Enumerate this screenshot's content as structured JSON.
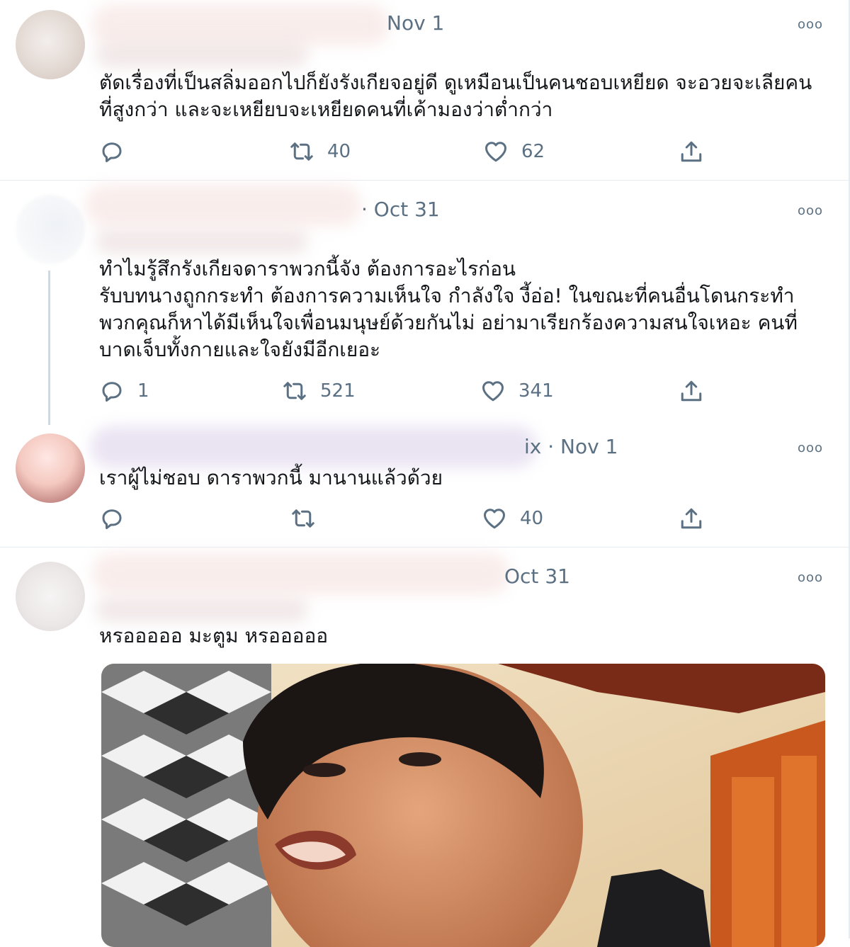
{
  "tweets": [
    {
      "date": "Nov 1",
      "text": "ตัดเรื่องที่เป็นสลิ่มออกไปก็ยังรังเกียจอยู่ดี ดูเหมือนเป็นคนชอบเหยียด จะอวยจะเลียคนที่สูงกว่า และจะเหยียบจะเหยียดคนที่เค้ามองว่าต่ำกว่า",
      "replies": "",
      "retweets": "40",
      "likes": "62"
    },
    {
      "date": "· Oct 31",
      "text": "ทำไมรู้สึกรังเกียจดาราพวกนี้จัง ต้องการอะไรก่อน\nรับบทนางถูกกระทำ ต้องการความเห็นใจ กำลังใจ งี้อ่อ! ในขณะที่คนอื่นโดนกระทำ\nพวกคุณก็หาได้มีเห็นใจเพื่อนมนุษย์ด้วยกันไม่ อย่ามาเรียกร้องความสนใจเหอะ คนที่\nบาดเจ็บทั้งกายและใจยังมีอีกเยอะ",
      "replies": "1",
      "retweets": "521",
      "likes": "341"
    },
    {
      "date": "ix · Nov 1",
      "text": "เราผู้ไม่ชอบ ดาราพวกนี้ มานานแล้วด้วย",
      "replies": "",
      "retweets": "",
      "likes": "40"
    },
    {
      "date": "Oct 31",
      "text": "หรอออออ มะตูม หรอออออ",
      "replies": "",
      "retweets": "",
      "likes": ""
    }
  ],
  "icons": {
    "reply": "reply-icon",
    "retweet": "retweet-icon",
    "like": "heart-icon",
    "share": "share-icon",
    "more": "more-icon"
  },
  "more_glyph": "ooo",
  "colors": {
    "text": "#14171a",
    "secondary": "#5b7083",
    "divider": "#e6ecf0"
  }
}
